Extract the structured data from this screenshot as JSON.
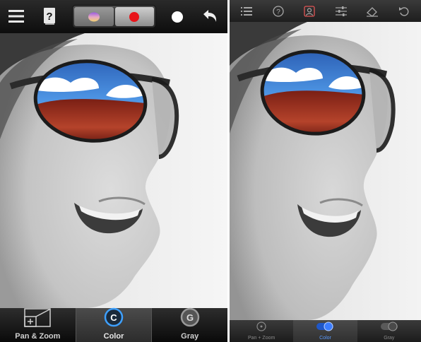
{
  "left_app": {
    "toolbar": {
      "icons": [
        "menu-icon",
        "help-icon",
        "color-mode-icon",
        "red-circle-icon",
        "brush-size-icon",
        "undo-icon"
      ]
    },
    "modes": [
      {
        "label": "Pan & Zoom",
        "icon": "pan-zoom-icon",
        "glyph": ""
      },
      {
        "label": "Color",
        "icon": "color-c-icon",
        "glyph": "C",
        "active": true
      },
      {
        "label": "Gray",
        "icon": "gray-g-icon",
        "glyph": "G"
      }
    ]
  },
  "right_app": {
    "toolbar": {
      "icons": [
        "list-icon",
        "help-icon",
        "person-icon",
        "sliders-icon",
        "eraser-icon",
        "undo-icon"
      ]
    },
    "modes": [
      {
        "label": "Pan + Zoom",
        "icon": "pan-zoom-icon"
      },
      {
        "label": "Color",
        "icon": "color-toggle-icon",
        "active": true
      },
      {
        "label": "Gray",
        "icon": "gray-toggle-icon"
      }
    ]
  },
  "colors": {
    "accent_blue": "#2f7bff",
    "toolbar_dark": "#1a1a1a",
    "lens_red": "#a8301f",
    "sky_blue": "#3c86d6"
  }
}
